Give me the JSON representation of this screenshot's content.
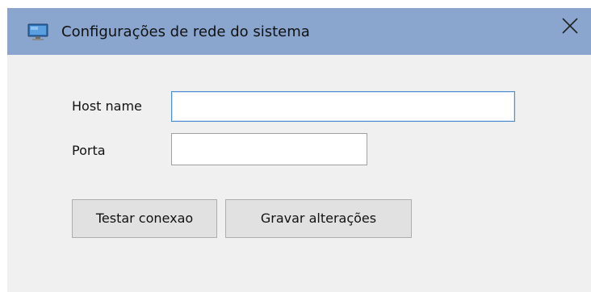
{
  "window": {
    "title": "Configurações de rede do sistema",
    "icon": "monitor-icon",
    "close_icon": "close-icon"
  },
  "form": {
    "host": {
      "label": "Host name",
      "value": "",
      "placeholder": ""
    },
    "port": {
      "label": "Porta",
      "value": "",
      "placeholder": ""
    }
  },
  "buttons": {
    "test_label": "Testar conexao",
    "save_label": "Gravar alterações"
  },
  "colors": {
    "titlebar": "#8aa6cf",
    "client": "#f0f0f0",
    "focus_border": "#4f8fd0"
  }
}
